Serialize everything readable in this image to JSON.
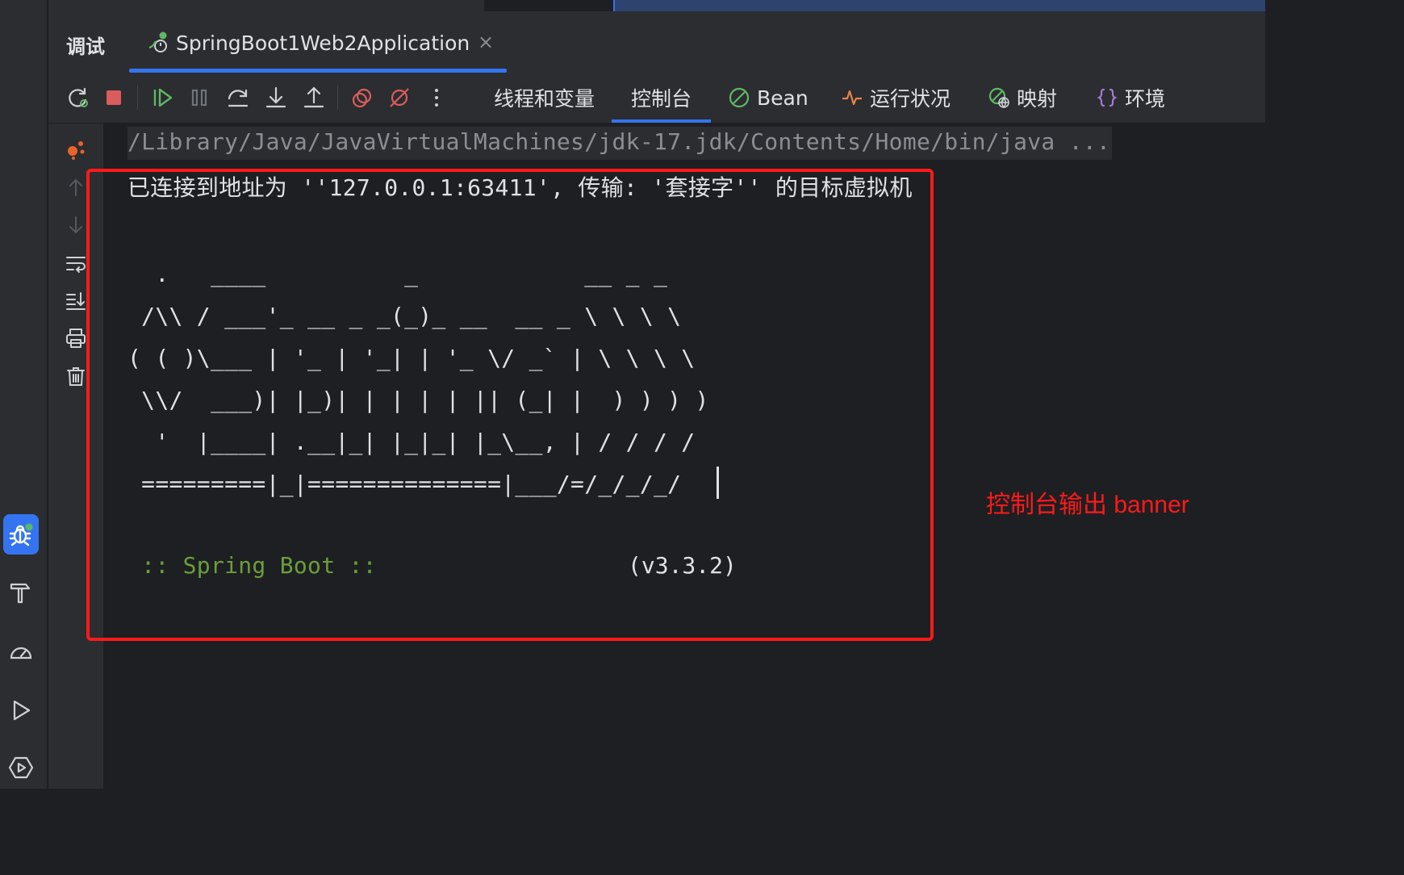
{
  "panel": {
    "title": "调试",
    "session_tab": {
      "label": "SpringBoot1Web2Application",
      "close": "×"
    }
  },
  "toolbar": {
    "view_tabs": [
      {
        "label": "线程和变量",
        "icon": ""
      },
      {
        "label": "控制台",
        "icon": "",
        "active": true
      },
      {
        "label": "Bean",
        "icon": "bean-icon"
      },
      {
        "label": "运行状况",
        "icon": "health-pulse-icon"
      },
      {
        "label": "映射",
        "icon": "mappings-globe-icon"
      },
      {
        "label": "环境",
        "icon": "braces-icon"
      }
    ],
    "debug_buttons": [
      "rerun-icon",
      "stop-icon",
      "resume-icon",
      "pause-icon",
      "step-over-icon",
      "step-into-icon",
      "step-out-icon",
      "view-breakpoints-icon",
      "mute-breakpoints-icon",
      "more-icon"
    ]
  },
  "console": {
    "command": "/Library/Java/JavaVirtualMachines/jdk-17.jdk/Contents/Home/bin/java ...",
    "connected": "已连接到地址为 ''127.0.0.1:63411', 传输: '套接字'' 的目标虚拟机",
    "banner": [
      "  .   ____          _            __ _ _",
      " /\\\\ / ___'_ __ _ _(_)_ __  __ _ \\ \\ \\ \\",
      "( ( )\\___ | '_ | '_| | '_ \\/ _` | \\ \\ \\ \\",
      " \\\\/  ___)| |_)| | | | | || (_| |  ) ) ) )",
      "  '  |____| .__|_| |_|_| |_\\__, | / / / /",
      " =========|_|==============|___/=/_/_/_/"
    ],
    "spring_boot": " :: Spring Boot :: ",
    "version": "(v3.3.2)"
  },
  "annotation": {
    "label": "控制台输出 banner",
    "color": "#ff1a1a"
  },
  "colors": {
    "accent": "#3574f0",
    "background": "#1e1f22",
    "panel": "#2b2d30",
    "spring_green": "#6a9f3a"
  }
}
